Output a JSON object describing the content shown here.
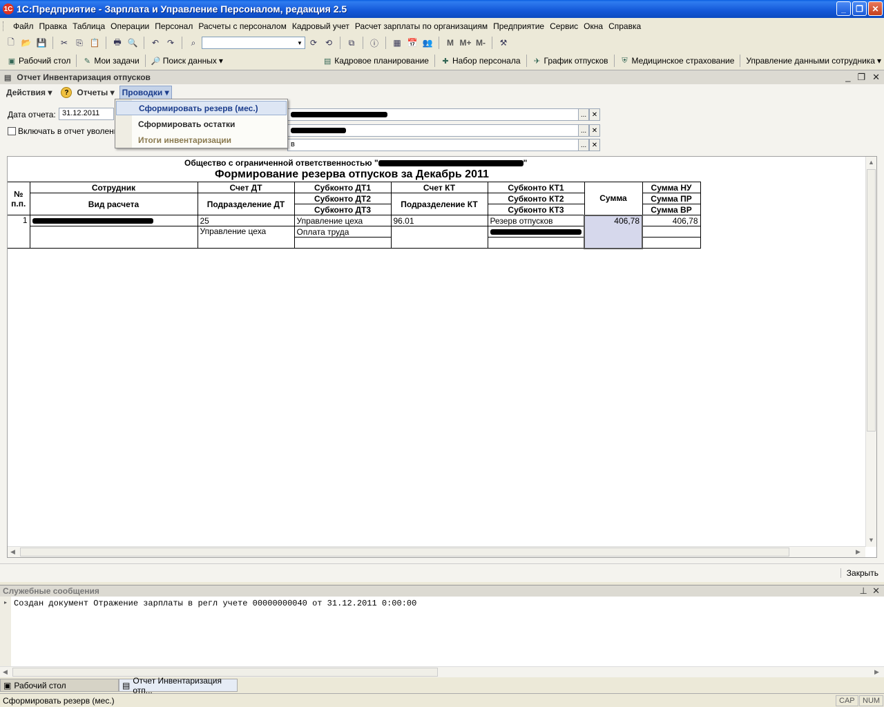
{
  "window": {
    "title": "1С:Предприятие - Зарплата и Управление Персоналом, редакция 2.5",
    "app_icon": "1C"
  },
  "menubar": [
    "Файл",
    "Правка",
    "Таблица",
    "Операции",
    "Персонал",
    "Расчеты с персоналом",
    "Кадровый учет",
    "Расчет зарплаты по организациям",
    "Предприятие",
    "Сервис",
    "Окна",
    "Справка"
  ],
  "toolbar": {
    "m_label": "M",
    "mplus_label": "M+",
    "mminus_label": "M-",
    "search_value": ""
  },
  "quickbar": {
    "desktop": "Рабочий стол",
    "tasks": "Мои задачи",
    "search": "Поиск данных",
    "hr_planning": "Кадровое планирование",
    "recruiting": "Набор персонала",
    "vacation_schedule": "График отпусков",
    "medical": "Медицинское страхование",
    "employee_data": "Управление данными сотрудника"
  },
  "doc": {
    "caption": "Отчет  Инвентаризация отпусков",
    "toolbar": {
      "actions": "Действия",
      "reports": "Отчеты",
      "postings": "Проводки"
    },
    "report_date_label": "Дата отчета:",
    "report_date_value": "31.12.2011",
    "include_dismissed_label": "Включать в отчет уволенны",
    "field3_tail": "в",
    "close_label": "Закрыть"
  },
  "dropdown": {
    "items": [
      "Сформировать резерв (мес.)",
      "Сформировать остатки",
      "Итоги инвентаризации"
    ]
  },
  "report": {
    "org_line": "Общество с ограниченной ответственностью \"",
    "org_line_end": "\"",
    "title": "Формирование резерва отпусков за Декабрь 2011",
    "headers": {
      "no": "№",
      "no2": "п.п.",
      "employee": "Сотрудник",
      "calc_type": "Вид расчета",
      "acc_dt": "Счет ДТ",
      "dept_dt": "Подразделение ДТ",
      "sub_dt1": "Субконто ДТ1",
      "sub_dt2": "Субконто ДТ2",
      "sub_dt3": "Субконто ДТ3",
      "acc_kt": "Счет КТ",
      "dept_kt": "Подразделение КТ",
      "sub_kt1": "Субконто КТ1",
      "sub_kt2": "Субконто КТ2",
      "sub_kt3": "Субконто КТ3",
      "sum": "Сумма",
      "sum_nu": "Сумма НУ",
      "sum_pr": "Сумма ПР",
      "sum_vr": "Сумма ВР"
    },
    "row": {
      "no": "1",
      "acc_dt": "25",
      "dept_dt": "Управление цеха",
      "sub_dt1": "Управление цеха",
      "sub_dt2": "Оплата труда",
      "acc_kt": "96.01",
      "sub_kt1": "Резерв отпусков",
      "sum": "406,78",
      "sum_nu": "406,78"
    }
  },
  "messages": {
    "caption": "Служебные сообщения",
    "line": "Создан документ Отражение зарплаты в регл учете 00000000040 от 31.12.2011 0:00:00"
  },
  "taskbar": [
    "Рабочий стол",
    "Отчет  Инвентаризация отп..."
  ],
  "statusbar": {
    "text": "Сформировать резерв (мес.)",
    "cap": "CAP",
    "num": "NUM"
  },
  "colors": {
    "title_bar": "#1458d8",
    "selected_cell": "#d6d8ec",
    "menu_hover": "#dde6f4"
  }
}
